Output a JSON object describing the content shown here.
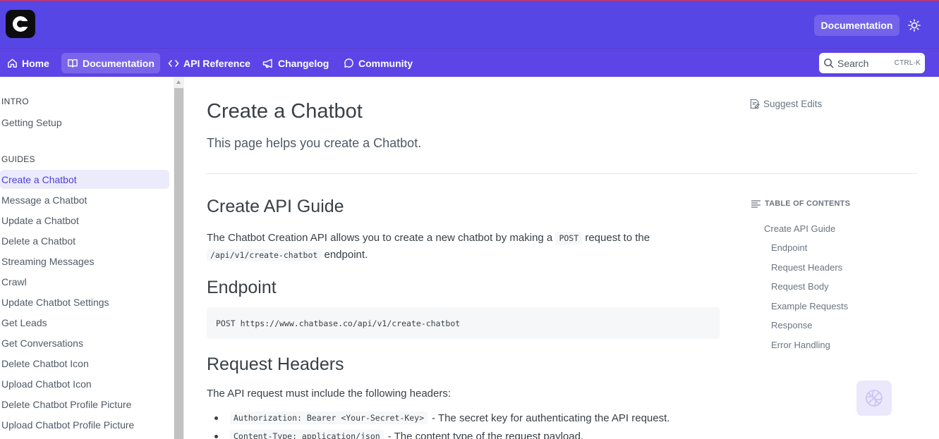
{
  "header": {
    "documentation_button": "Documentation"
  },
  "nav": {
    "items": [
      {
        "label": "Home",
        "icon": "home-icon"
      },
      {
        "label": "Documentation",
        "icon": "book-icon"
      },
      {
        "label": "API Reference",
        "icon": "code-icon"
      },
      {
        "label": "Changelog",
        "icon": "megaphone-icon"
      },
      {
        "label": "Community",
        "icon": "chat-bubble-icon"
      }
    ],
    "search_label": "Search",
    "search_shortcut": "CTRL-K"
  },
  "sidebar": {
    "sections": [
      {
        "title": "INTRO",
        "items": [
          "Getting Setup"
        ]
      },
      {
        "title": "GUIDES",
        "items": [
          "Create a Chatbot",
          "Message a Chatbot",
          "Update a Chatbot",
          "Delete a Chatbot",
          "Streaming Messages",
          "Crawl",
          "Update Chatbot Settings",
          "Get Leads",
          "Get Conversations",
          "Delete Chatbot Icon",
          "Upload Chatbot Icon",
          "Delete Chatbot Profile Picture",
          "Upload Chatbot Profile Picture"
        ]
      }
    ],
    "active_item": "Create a Chatbot"
  },
  "page": {
    "title": "Create a Chatbot",
    "subtitle": "This page helps you create a Chatbot.",
    "suggest_edits": "Suggest Edits",
    "section_api_guide": "Create API Guide",
    "intro_text_1": "The Chatbot Creation API allows you to create a new chatbot by making a",
    "intro_code_1": "POST",
    "intro_text_2": "request to the",
    "intro_code_2": "/api/v1/create-chatbot",
    "intro_text_3": "endpoint.",
    "section_endpoint": "Endpoint",
    "endpoint_code": "POST https://www.chatbase.co/api/v1/create-chatbot",
    "section_headers": "Request Headers",
    "headers_intro": "The API request must include the following headers:",
    "header_bullet_1_code": "Authorization: Bearer <Your-Secret-Key>",
    "header_bullet_1_text": "- The secret key for authenticating the API request.",
    "header_bullet_2_code": "Content-Type: application/json",
    "header_bullet_2_text": "- The content type of the request payload."
  },
  "toc": {
    "title": "TABLE OF CONTENTS",
    "items": [
      "Create API Guide",
      "Endpoint",
      "Request Headers",
      "Request Body",
      "Example Requests",
      "Response",
      "Error Handling"
    ]
  },
  "colors": {
    "brand": "#5746e6",
    "active_bg": "#ecebfc",
    "active_text": "#4d3fd8"
  }
}
